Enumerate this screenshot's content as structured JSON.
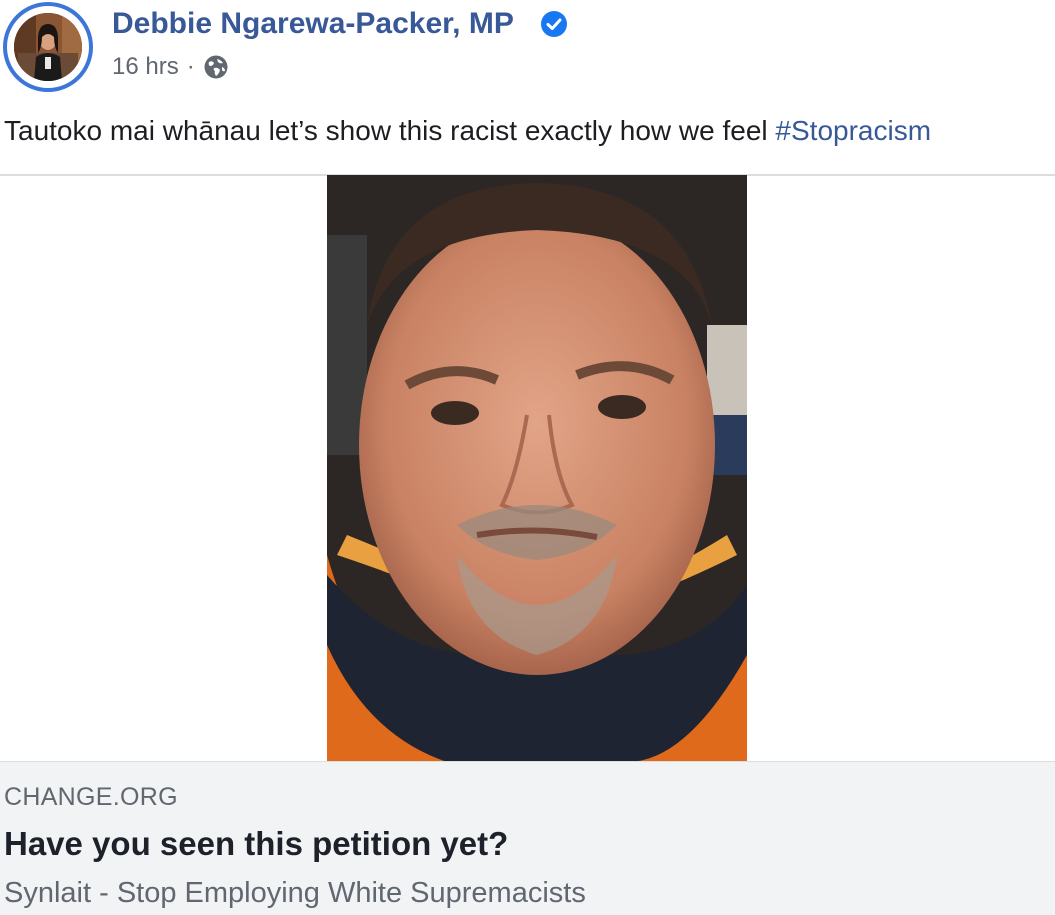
{
  "post": {
    "author": {
      "name": "Debbie Ngarewa-Packer, MP",
      "verified": true,
      "avatar_icon": "profile-photo"
    },
    "timestamp": "16 hrs",
    "separator": "·",
    "privacy_icon": "globe-icon",
    "text": "Tautoko mai whānau let’s show this racist exactly how we feel ",
    "hashtag": "#Stopracism"
  },
  "link_preview": {
    "source": "CHANGE.ORG",
    "title": "Have you seen this petition yet?",
    "description": "Synlait - Stop Employing White Supremacists"
  },
  "colors": {
    "link_blue": "#385898",
    "verified_blue": "#1877f2",
    "secondary_text": "#606770",
    "preview_background": "#f2f3f5"
  }
}
